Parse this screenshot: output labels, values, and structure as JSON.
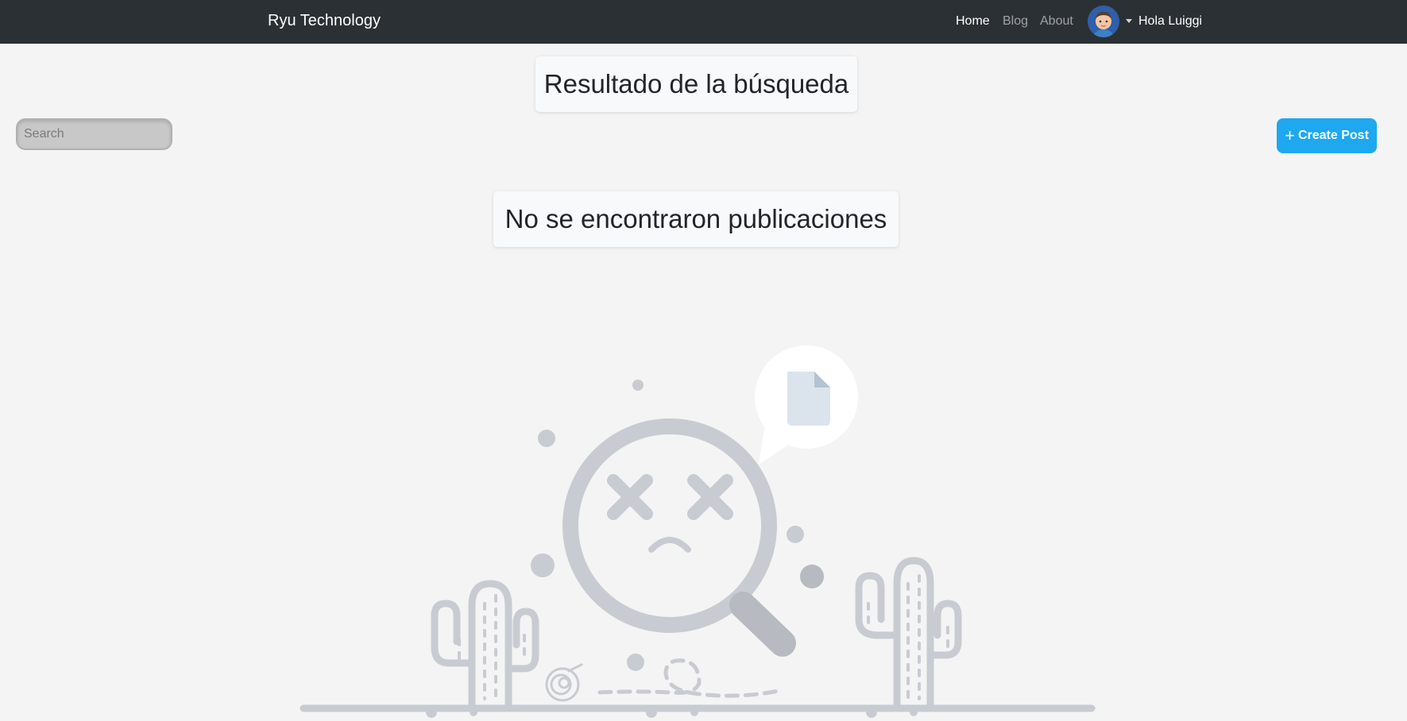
{
  "navbar": {
    "brand": "Ryu Technology",
    "links": [
      {
        "label": "Home",
        "active": true
      },
      {
        "label": "Blog",
        "active": false
      },
      {
        "label": "About",
        "active": false
      }
    ],
    "greeting": "Hola Luiggi"
  },
  "page": {
    "title": "Resultado de la búsqueda",
    "empty_message": "No se encontraron publicaciones"
  },
  "search": {
    "placeholder": "Search",
    "value": ""
  },
  "toolbar": {
    "create_icon": "+",
    "create_label": "Create Post"
  },
  "colors": {
    "navbar": "#2b3035",
    "background": "#f4f4f4",
    "accent": "#1da8f0",
    "illustration": "#c9cbd2"
  },
  "icons": [
    "user-avatar",
    "plus-icon",
    "no-results-illustration"
  ]
}
